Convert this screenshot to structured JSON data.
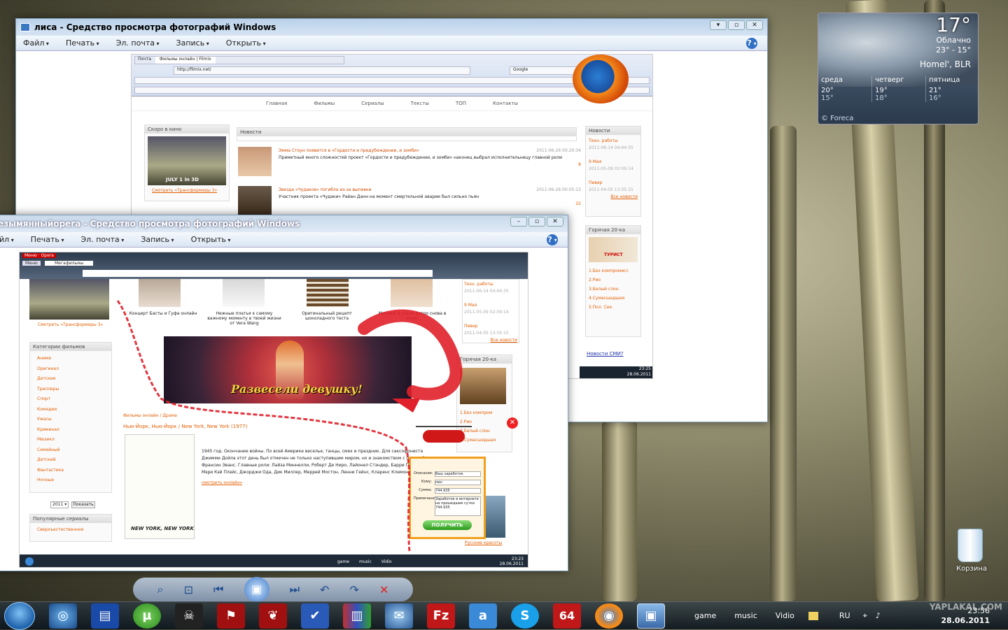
{
  "desktop": {
    "recycle_label": "Корзина"
  },
  "window1": {
    "title": "лиса - Средство просмотра фотографий Windows",
    "menu": [
      "Файл",
      "Печать",
      "Эл. почта",
      "Запись",
      "Открыть"
    ],
    "tabs": [
      "Почта",
      "Фильмы онлайн | Filmix"
    ],
    "url": "http://filmix.net/",
    "search": "Google",
    "nav": [
      "Главная",
      "Фильмы",
      "Сериалы",
      "Тексты",
      "ТОП",
      "Контакты"
    ],
    "soon_title": "Скоро в кино",
    "soon_poster": "JULY 1 in 3D",
    "soon_caption": "Смотреть «Трансформеры 3»",
    "news_title": "Новости",
    "news": [
      {
        "title": "Эмма Стоун появится в «Гордости и предубеждении, и зомби»",
        "date": "2011-06-26 00:20:34",
        "text": "Приметный много сложностей проект «Гордости и предубеждении, и зомби» наконец выбрал исполнительницу главной роли",
        "count": "8"
      },
      {
        "title": "Звезда «Чудаков» погибла из-за выпивки",
        "date": "2011-06-26 00:05:13",
        "text": "Участник проекта «Чудаки» Райан Данн на момент смертельной аварии был сильно пьян",
        "count": "22"
      }
    ],
    "side_title": "Новости",
    "side": [
      {
        "title": "Техн. работы",
        "date": "2011-06-14 04:44:35"
      },
      {
        "title": "9 Мая",
        "date": "2011-05-09 02:09:14"
      },
      {
        "title": "Пивер",
        "date": "2011-04-05 13:35:15"
      }
    ],
    "all_news": "Все новости",
    "hot_title": "Горячая 20-ка",
    "hot_poster": "ТУРИСТ",
    "hot": [
      "1.Без компромисс",
      "2.Рио",
      "3.Белый слон",
      "4.Сумасшедшая",
      "5.Пол. Сек."
    ],
    "news_link": "Новости СМИ?",
    "clock": "23:25",
    "clock_date": "28.06.2011"
  },
  "window2": {
    "title": "езымянныйopera - Средство просмотра фотографий Windows",
    "menu": [
      "йл",
      "Печать",
      "Эл. почта",
      "Запись",
      "Открыть"
    ],
    "tabs": [
      "Меню",
      "Мегафильмы"
    ],
    "opera_label": "Меню · Opera",
    "poster_caption": "Смотреть «Трансформеры 3»",
    "gallery": [
      "Концерт Басты и Гуфа онлайн",
      "Нежные платья к самому важному моменту в твоей жизни от Vera Wang",
      "Оригинальный рецепт шоколадного теста",
      "Макияж в стиле ретро снова в моде!"
    ],
    "categories_title": "Категории фильмов",
    "categories": [
      "Аниме",
      "Оригинал",
      "Детские",
      "Триллеры",
      "Спорт",
      "Комедии",
      "Ужасы",
      "Криминал",
      "Мюзикл",
      "Семейный",
      "Детский",
      "Фантастика",
      "Ночные"
    ],
    "year": "2011",
    "show_btn": "Показать",
    "popular_title": "Популярные сериалы",
    "popular_first": "Сверхъестественное",
    "banner": "Развесели девушку!",
    "breadcrumb": "Фильмы онлайн / Драма",
    "film_title": "Нью-Йорк, Нью-Йорк / New York, New York (1977)",
    "film_poster": "NEW YORK, NEW YORK",
    "film_text": "1945 год. Окончание войны. По всей Америке веселье, танцы, смех и праздник. Для саксофониста Джимми Дойла этот день был отмечен не только наступившим миром, но и знакомством с певицей Франсин Эванс. Главные роли: Лайза Миннелли, Роберт Де Ниро, Лайонел Стэндер, Барри Праймус, Мэри Кэй Плэйс, Джорджи Ода, Дик Миллер, Меррей Мостон, Ленни Гейнс, Кларенс Клемонс и др.",
    "watch_link": "смотреть онлайн»",
    "side": [
      {
        "title": "Техн. работы",
        "date": "2011-06-14 04:44:35"
      },
      {
        "title": "9 Мая",
        "date": "2011-05-09 02:09:14"
      },
      {
        "title": "Пивер",
        "date": "2011-04-05 13:35:15"
      }
    ],
    "all_news": "Все новости",
    "hot_title": "Горячая 20-ка",
    "hot": [
      "1.Без компром",
      "2.Рио",
      "3.Белый слон",
      "4.Сумасшедшая"
    ],
    "hot_caption": "Русские красоты",
    "popup": {
      "desc_label": "Описание:",
      "desc_value": "Ваш заработок",
      "sum_label": "Кому:",
      "sum_value": "пин",
      "amount_label": "Сумма:",
      "amount_value": "744.935",
      "note_label": "Примечание:",
      "note_value": "Заработок в интернете на прошедшие сутки 744.935",
      "button": "ПОЛУЧИТЬ"
    },
    "taskbar_items": [
      "game",
      "music",
      "Vidio"
    ],
    "clock": "23:23",
    "clock_date": "28.06.2011"
  },
  "weather": {
    "temp": "17°",
    "cond": "Облачно",
    "range": "23° - 15°",
    "city": "Homel', BLR",
    "days": [
      {
        "name": "среда",
        "hi": "20°",
        "lo": "15°"
      },
      {
        "name": "четверг",
        "hi": "19°",
        "lo": "18°"
      },
      {
        "name": "пятница",
        "hi": "21°",
        "lo": "16°"
      }
    ],
    "source": "© Foreca"
  },
  "taskbar": {
    "toolbars": [
      "game",
      "music",
      "Vidio"
    ],
    "lang": "RU",
    "time": "23:56",
    "date": "28.06.2011",
    "watermark": "YAPLAKAL.COM",
    "icon_64": "64"
  },
  "colors": {
    "accent": "#e35d00",
    "link": "#c0392b",
    "scribble": "#e0202a"
  }
}
